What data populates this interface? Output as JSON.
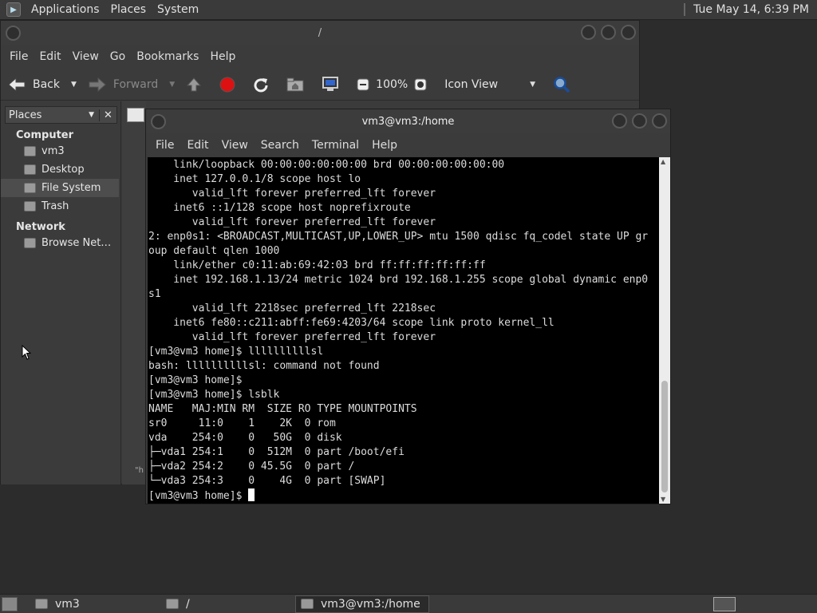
{
  "top_panel": {
    "menus": [
      "Applications",
      "Places",
      "System"
    ],
    "clock": "Tue May 14,  6:39 PM"
  },
  "file_manager": {
    "title": "/",
    "menus": [
      "File",
      "Edit",
      "View",
      "Go",
      "Bookmarks",
      "Help"
    ],
    "toolbar": {
      "back": "Back",
      "forward": "Forward",
      "zoom": "100%",
      "view_mode": "Icon View"
    },
    "sidebar": {
      "header": "Places",
      "sections": [
        {
          "title": "Computer",
          "items": [
            {
              "label": "vm3",
              "icon": "home-folder-icon"
            },
            {
              "label": "Desktop",
              "icon": "desktop-folder-icon"
            },
            {
              "label": "File System",
              "icon": "harddisk-icon",
              "selected": true
            },
            {
              "label": "Trash",
              "icon": "trash-icon"
            }
          ]
        },
        {
          "title": "Network",
          "items": [
            {
              "label": "Browse Net…",
              "icon": "network-icon"
            }
          ]
        }
      ]
    },
    "status_fragment": "\"h"
  },
  "terminal": {
    "title": "vm3@vm3:/home",
    "menus": [
      "File",
      "Edit",
      "View",
      "Search",
      "Terminal",
      "Help"
    ],
    "lines": [
      "    link/loopback 00:00:00:00:00:00 brd 00:00:00:00:00:00",
      "    inet 127.0.0.1/8 scope host lo",
      "       valid_lft forever preferred_lft forever",
      "    inet6 ::1/128 scope host noprefixroute",
      "       valid_lft forever preferred_lft forever",
      "2: enp0s1: <BROADCAST,MULTICAST,UP,LOWER_UP> mtu 1500 qdisc fq_codel state UP gr",
      "oup default qlen 1000",
      "    link/ether c0:11:ab:69:42:03 brd ff:ff:ff:ff:ff:ff",
      "    inet 192.168.1.13/24 metric 1024 brd 192.168.1.255 scope global dynamic enp0",
      "s1",
      "       valid_lft 2218sec preferred_lft 2218sec",
      "    inet6 fe80::c211:abff:fe69:4203/64 scope link proto kernel_ll",
      "       valid_lft forever preferred_lft forever",
      "[vm3@vm3 home]$ llllllllllsl",
      "bash: llllllllllsl: command not found",
      "[vm3@vm3 home]$",
      "[vm3@vm3 home]$ lsblk",
      "NAME   MAJ:MIN RM  SIZE RO TYPE MOUNTPOINTS",
      "sr0     11:0    1    2K  0 rom",
      "vda    254:0    0   50G  0 disk",
      "├─vda1 254:1    0  512M  0 part /boot/efi",
      "├─vda2 254:2    0 45.5G  0 part /",
      "└─vda3 254:3    0    4G  0 part [SWAP]"
    ],
    "prompt": "[vm3@vm3 home]$ "
  },
  "taskbar": {
    "tasks": [
      {
        "label": "vm3",
        "active": false
      },
      {
        "label": "/",
        "active": false
      },
      {
        "label": "vm3@vm3:/home",
        "active": true
      }
    ]
  }
}
